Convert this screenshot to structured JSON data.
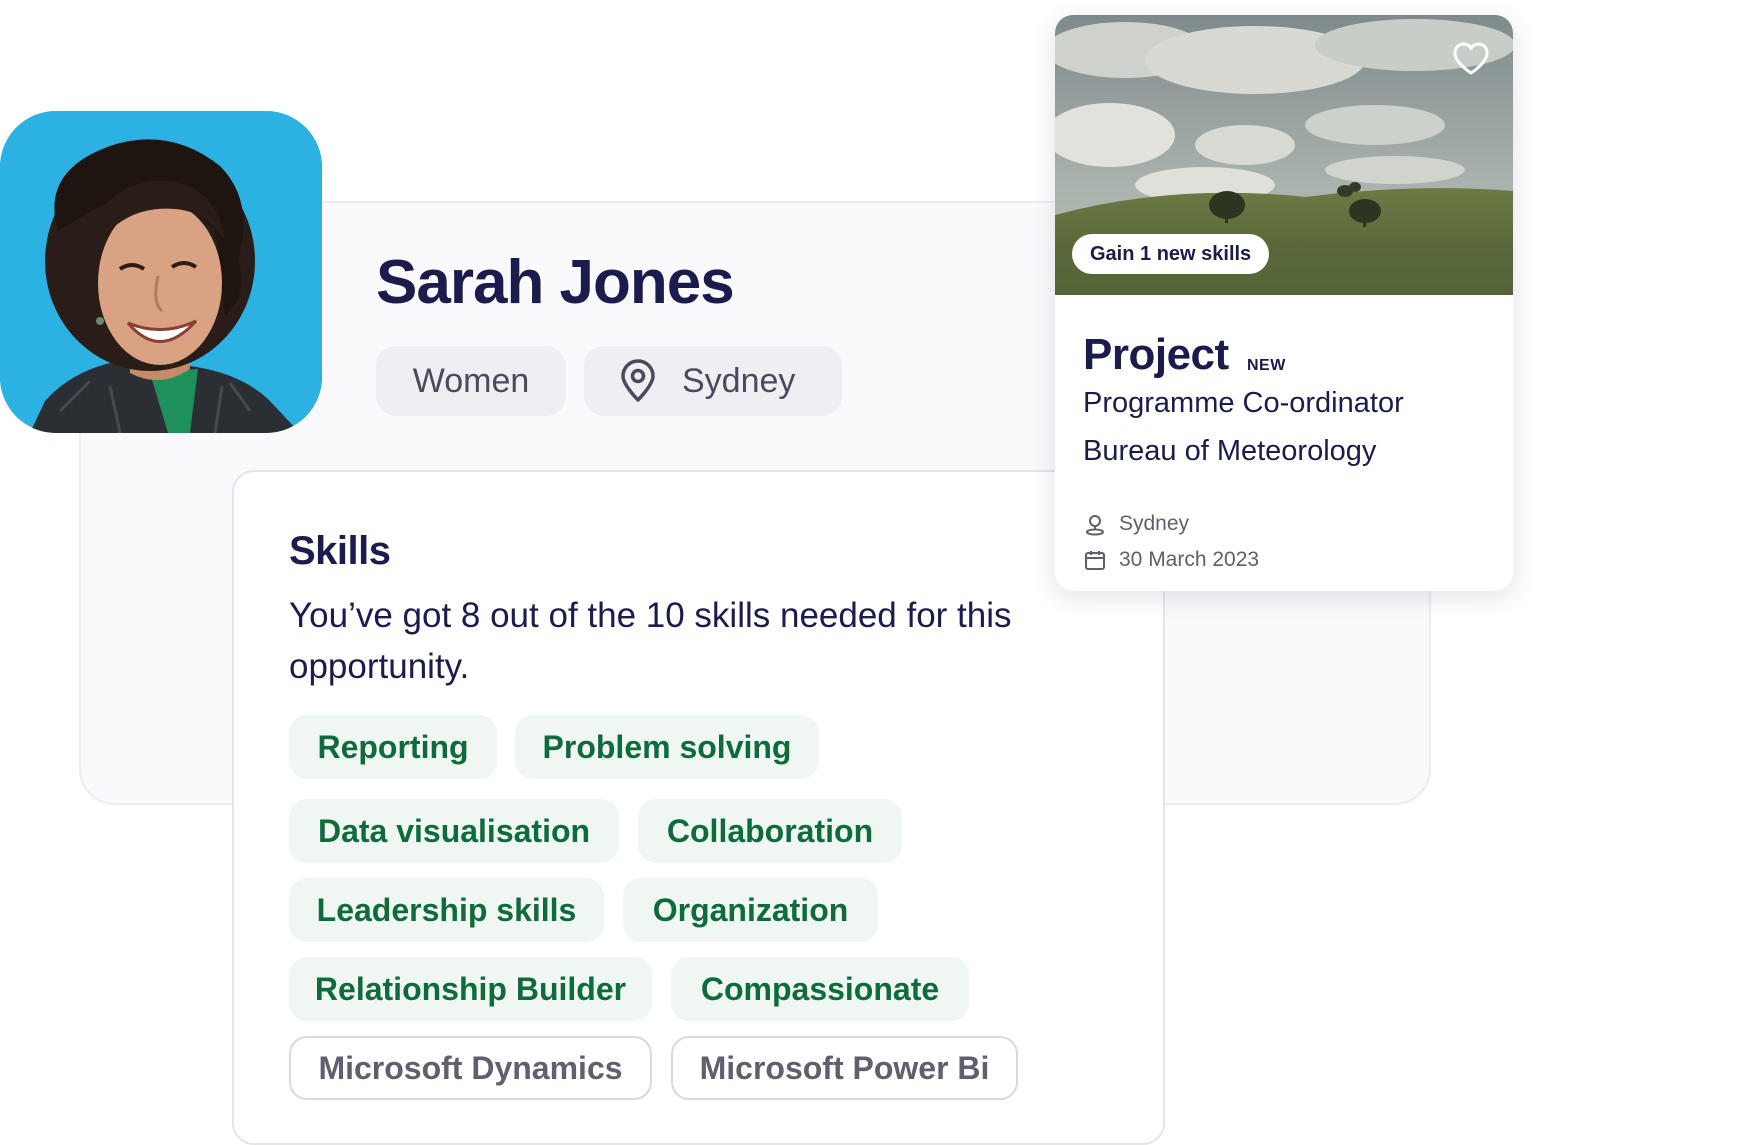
{
  "profile": {
    "name": "Sarah Jones",
    "group_tag": "Women",
    "location": "Sydney"
  },
  "skills": {
    "title": "Skills",
    "summary": "You’ve got 8 out of the 10 skills needed for this opportunity.",
    "matched": [
      "Reporting",
      "Problem solving",
      "Data visualisation",
      "Collaboration",
      "Leadership skills",
      "Organization",
      "Relationship Builder",
      "Compassionate"
    ],
    "missing": [
      "Microsoft Dynamics",
      "Microsoft Power Bi"
    ]
  },
  "opportunity": {
    "badge": "Gain 1 new skills",
    "type": "Project",
    "new_label": "NEW",
    "role": "Programme Co-ordinator",
    "organisation": "Bureau of Meteorology",
    "location": "Sydney",
    "date": "30 March 2023"
  },
  "icons": {
    "pin": "location-pin-icon",
    "heart": "heart-icon",
    "person": "person-pin-icon",
    "calendar": "calendar-icon"
  },
  "colors": {
    "primary_text": "#1c1b4e",
    "skill_green": "#0e6b3b",
    "skill_bg": "#f0f7f2",
    "avatar_bg": "#2cb1e3"
  }
}
